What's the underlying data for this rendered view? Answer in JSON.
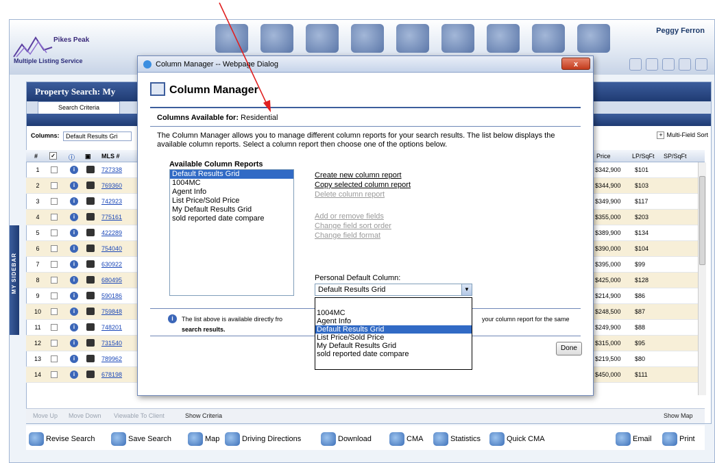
{
  "app": {
    "logo_brand": "Pikes Peak",
    "logo_sub": "Multiple Listing Service",
    "user_name": "Peggy Ferron",
    "panel_title": "Property Search:  My",
    "search_tab": "Search Criteria",
    "columns_label": "Columns:",
    "columns_value": "Default Results Gri",
    "multi_sort": "Multi-Field Sort"
  },
  "grid": {
    "headers": {
      "num": "#",
      "mls": "MLS #",
      "price": "Price",
      "lpsqft": "LP/SqFt",
      "spsqft": "SP/SqFt"
    },
    "rows": [
      {
        "n": "1",
        "mls": "727338",
        "price": "$342,900",
        "lp": "$101"
      },
      {
        "n": "2",
        "mls": "769360",
        "price": "$344,900",
        "lp": "$103"
      },
      {
        "n": "3",
        "mls": "742923",
        "price": "$349,900",
        "lp": "$117"
      },
      {
        "n": "4",
        "mls": "775161",
        "price": "$355,000",
        "lp": "$203"
      },
      {
        "n": "5",
        "mls": "422289",
        "price": "$389,900",
        "lp": "$134"
      },
      {
        "n": "6",
        "mls": "754040",
        "price": "$390,000",
        "lp": "$104"
      },
      {
        "n": "7",
        "mls": "630922",
        "price": "$395,000",
        "lp": "$99"
      },
      {
        "n": "8",
        "mls": "680495",
        "price": "$425,000",
        "lp": "$128"
      },
      {
        "n": "9",
        "mls": "590186",
        "price": "$214,900",
        "lp": "$86"
      },
      {
        "n": "10",
        "mls": "759848",
        "price": "$248,500",
        "lp": "$87"
      },
      {
        "n": "11",
        "mls": "748201",
        "price": "$249,900",
        "lp": "$88"
      },
      {
        "n": "12",
        "mls": "731540",
        "price": "$315,000",
        "lp": "$95"
      },
      {
        "n": "13",
        "mls": "789962",
        "price": "$219,500",
        "lp": "$80"
      },
      {
        "n": "14",
        "mls": "678198",
        "price": "$450,000",
        "lp": "$111"
      }
    ]
  },
  "sidebar_tab": "MY SIDEBAR",
  "toolbar1": {
    "move_up": "Move Up",
    "move_down": "Move Down",
    "viewable": "Viewable To Client",
    "show_criteria": "Show Criteria",
    "show_map": "Show Map"
  },
  "toolbar2": {
    "revise": "Revise Search",
    "save": "Save Search",
    "map": "Map",
    "driving": "Driving Directions",
    "download": "Download",
    "cma": "CMA",
    "statistics": "Statistics",
    "quick_cma": "Quick CMA",
    "email": "Email",
    "print": "Print"
  },
  "dialog": {
    "window_title": "Column Manager -- Webpage Dialog",
    "close_label": "x",
    "heading": "Column Manager",
    "avail_for_label": "Columns Available for:",
    "avail_for_value": "Residential",
    "description": "The Column Manager allows you to manage different column reports for your search results. The list below displays the available column reports. Select a column report then choose one of the options below.",
    "reports_label": "Available Column Reports",
    "reports": [
      "Default Results Grid",
      "1004MC",
      "Agent Info",
      "List Price/Sold Price",
      "My Default Results Grid",
      "sold reported date compare"
    ],
    "links": {
      "create": "Create new column report",
      "copy": "Copy selected column report",
      "delete": "Delete column report",
      "add_remove": "Add or remove fields",
      "sort_order": "Change field sort order",
      "format": "Change field format"
    },
    "personal_default_label": "Personal Default Column:",
    "personal_default_value": "Default Results Grid",
    "dropdown_options": [
      "",
      "1004MC",
      "Agent Info",
      "Default Results Grid",
      "List Price/Sold Price",
      "My Default Results Grid",
      "sold reported date compare"
    ],
    "note_part1": "The list above is available directly fro",
    "note_part2": "your column report for the same",
    "note_part3": "search results.",
    "done_label": "Done"
  },
  "colors": {
    "accent": "#1f3b73",
    "selection": "#316ac5",
    "annotation_arrow": "#e02020",
    "alt_row": "#f7efd8"
  }
}
